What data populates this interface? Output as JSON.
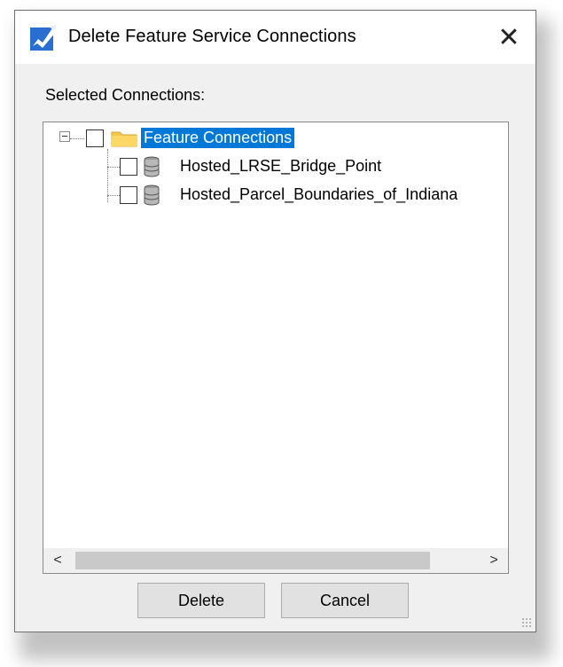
{
  "dialog": {
    "title": "Delete Feature Service Connections",
    "icon": "app-icon",
    "close_glyph": "✕"
  },
  "section_label": "Selected Connections:",
  "tree": {
    "root": {
      "label": "Feature Connections",
      "expanded": true,
      "checked": false,
      "icon": "folder-icon"
    },
    "items": [
      {
        "label": "Hosted_LRSE_Bridge_Point",
        "checked": false,
        "icon": "database-icon"
      },
      {
        "label": "Hosted_Parcel_Boundaries_of_Indiana",
        "checked": false,
        "icon": "database-icon"
      }
    ]
  },
  "scrollbar": {
    "left_glyph": "<",
    "right_glyph": ">"
  },
  "buttons": {
    "delete_label": "Delete",
    "cancel_label": "Cancel"
  },
  "colors": {
    "selection": "#0078d7",
    "folder": "#f5c84c",
    "dialog_bg": "#f0f0f0"
  }
}
